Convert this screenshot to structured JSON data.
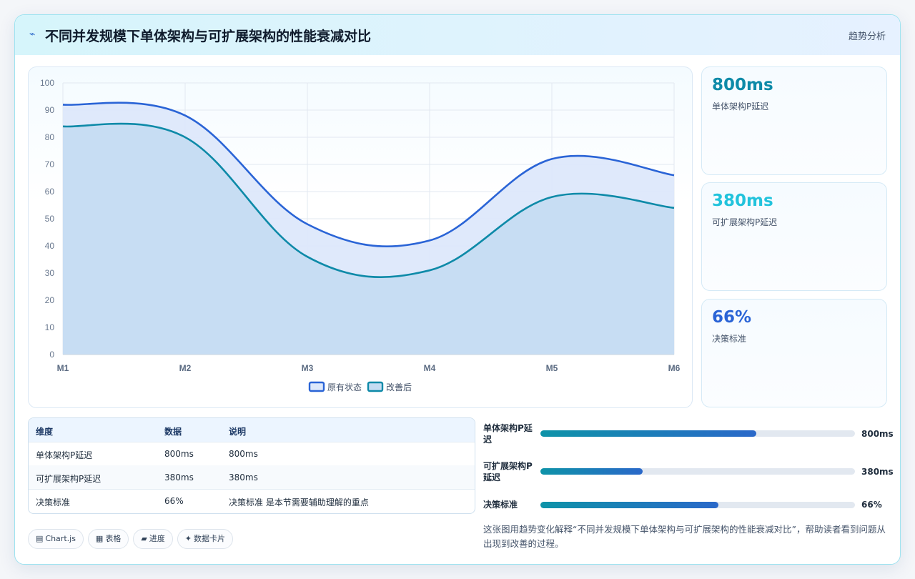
{
  "header": {
    "icon": "chart-trend-icon",
    "title": "不同并发规模下单体架构与可扩展架构的性能衰减对比",
    "tag": "趋势分析"
  },
  "chart_data": {
    "type": "area",
    "categories": [
      "M1",
      "M2",
      "M3",
      "M4",
      "M5",
      "M6"
    ],
    "series": [
      {
        "name": "原有状态",
        "values": [
          92,
          88,
          48,
          42,
          72,
          66
        ],
        "color": "#2a64d6",
        "fill": "#dde8fb"
      },
      {
        "name": "改善后",
        "values": [
          84,
          80,
          36,
          31,
          58,
          54
        ],
        "color": "#0e8aa8",
        "fill": "#c4dcf2"
      }
    ],
    "y_ticks": [
      "0",
      "10",
      "20",
      "30",
      "40",
      "50",
      "60",
      "70",
      "80",
      "90",
      "100"
    ],
    "ylim": [
      0,
      100
    ],
    "grid": true,
    "legend": "bottom"
  },
  "stats": [
    {
      "value": "800ms",
      "label": "单体架构P延迟",
      "color": "#0e8aa8"
    },
    {
      "value": "380ms",
      "label": "可扩展架构P延迟",
      "color": "#22c3dc"
    },
    {
      "value": "66%",
      "label": "决策标准",
      "color": "#2a64d6"
    }
  ],
  "table": {
    "headers": [
      "维度",
      "数据",
      "说明"
    ],
    "rows": [
      [
        "单体架构P延迟",
        "800ms",
        "800ms"
      ],
      [
        "可扩展架构P延迟",
        "380ms",
        "380ms"
      ],
      [
        "决策标准",
        "66%",
        "决策标准 是本节需要辅助理解的重点"
      ]
    ]
  },
  "progress": [
    {
      "name": "单体架构P延迟",
      "value_label": "800ms",
      "fraction": 0.686
    },
    {
      "name": "可扩展架构P延迟",
      "value_label": "380ms",
      "fraction": 0.325
    },
    {
      "name": "决策标准",
      "value_label": "66%",
      "fraction": 0.566
    }
  ],
  "chips": [
    {
      "icon": "chart-icon",
      "glyph": "▤",
      "label": "Chart.js"
    },
    {
      "icon": "table-icon",
      "glyph": "▦",
      "label": "表格"
    },
    {
      "icon": "progress-icon",
      "glyph": "▰",
      "label": "进度"
    },
    {
      "icon": "sparkle-icon",
      "glyph": "✦",
      "label": "数据卡片"
    }
  ],
  "note": "这张图用趋势变化解释“不同并发规模下单体架构与可扩展架构的性能衰减对比”，帮助读者看到问题从出现到改善的过程。"
}
